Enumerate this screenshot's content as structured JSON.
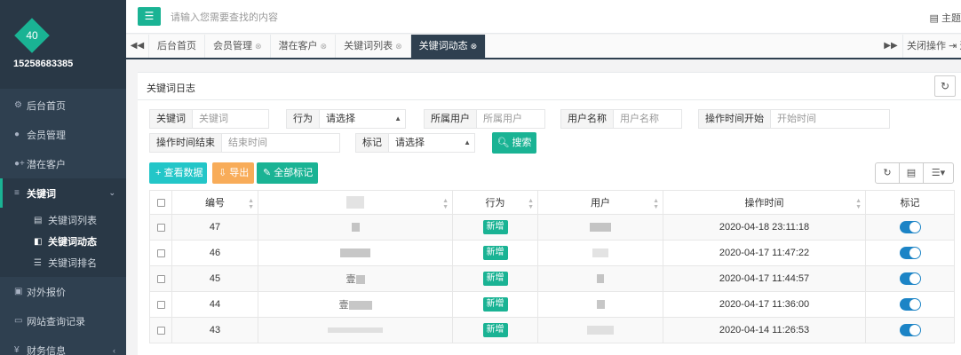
{
  "sidebar": {
    "avatar_text": "40",
    "phone": "15258683385",
    "items": [
      {
        "icon": "gears-icon",
        "label": "后台首页",
        "glyph": "⚙"
      },
      {
        "icon": "user-icon",
        "label": "会员管理",
        "glyph": "👤"
      },
      {
        "icon": "user-plus-icon",
        "label": "潜在客户",
        "glyph": "+"
      },
      {
        "icon": "bars-icon",
        "label": "关键词",
        "glyph": "≡"
      },
      {
        "icon": "money-icon",
        "label": "对外报价",
        "glyph": "▣"
      },
      {
        "icon": "desktop-icon",
        "label": "网站查询记录",
        "glyph": "▭"
      },
      {
        "icon": "yen-icon",
        "label": "财务信息",
        "glyph": "¥"
      }
    ],
    "submenu": [
      {
        "icon": "list-alt-icon",
        "label": "关键词列表"
      },
      {
        "icon": "book-icon",
        "label": "关键词动态"
      },
      {
        "icon": "list-ol-icon",
        "label": "关键词排名"
      }
    ]
  },
  "topbar": {
    "menu_glyph": "☰",
    "search_placeholder": "请输入您需要查找的内容",
    "theme_label": "主题"
  },
  "tabs": {
    "items": [
      "后台首页",
      "会员管理",
      "潜在客户",
      "关键词列表",
      "关键词动态"
    ],
    "active_index": 4,
    "close_ops": "关闭操作",
    "close_tail": "⇥ 退"
  },
  "panel": {
    "title": "关键词日志",
    "filters": {
      "keyword_label": "关键词",
      "keyword_placeholder": "关键词",
      "action_label": "行为",
      "action_value": "请选择",
      "owner_label": "所属用户",
      "owner_placeholder": "所属用户",
      "username_label": "用户名称",
      "username_placeholder": "用户名称",
      "start_label": "操作时间开始",
      "start_placeholder": "开始时间",
      "end_label": "操作时间结束",
      "end_placeholder": "结束时间",
      "mark_label": "标记",
      "mark_value": "请选择"
    },
    "search_button": "搜索",
    "toolbar": {
      "view": "查看数据",
      "export": "导出",
      "mark_all": "全部标记"
    }
  },
  "table": {
    "headers": [
      "编号",
      "",
      "行为",
      "用户",
      "操作时间",
      "标记"
    ],
    "rows": [
      {
        "id": "47",
        "keyword": "",
        "action": "新增",
        "user": "",
        "time": "2020-04-18 23:11:18",
        "marked": true
      },
      {
        "id": "46",
        "keyword": "",
        "action": "新增",
        "user": "",
        "time": "2020-04-17 11:47:22",
        "marked": true
      },
      {
        "id": "45",
        "keyword": "壹",
        "action": "新增",
        "user": "",
        "time": "2020-04-17 11:44:57",
        "marked": true
      },
      {
        "id": "44",
        "keyword": "壹",
        "action": "新增",
        "user": "",
        "time": "2020-04-17 11:36:00",
        "marked": true
      },
      {
        "id": "43",
        "keyword": "",
        "action": "新增",
        "user": "",
        "time": "2020-04-14 11:26:53",
        "marked": true
      }
    ]
  }
}
